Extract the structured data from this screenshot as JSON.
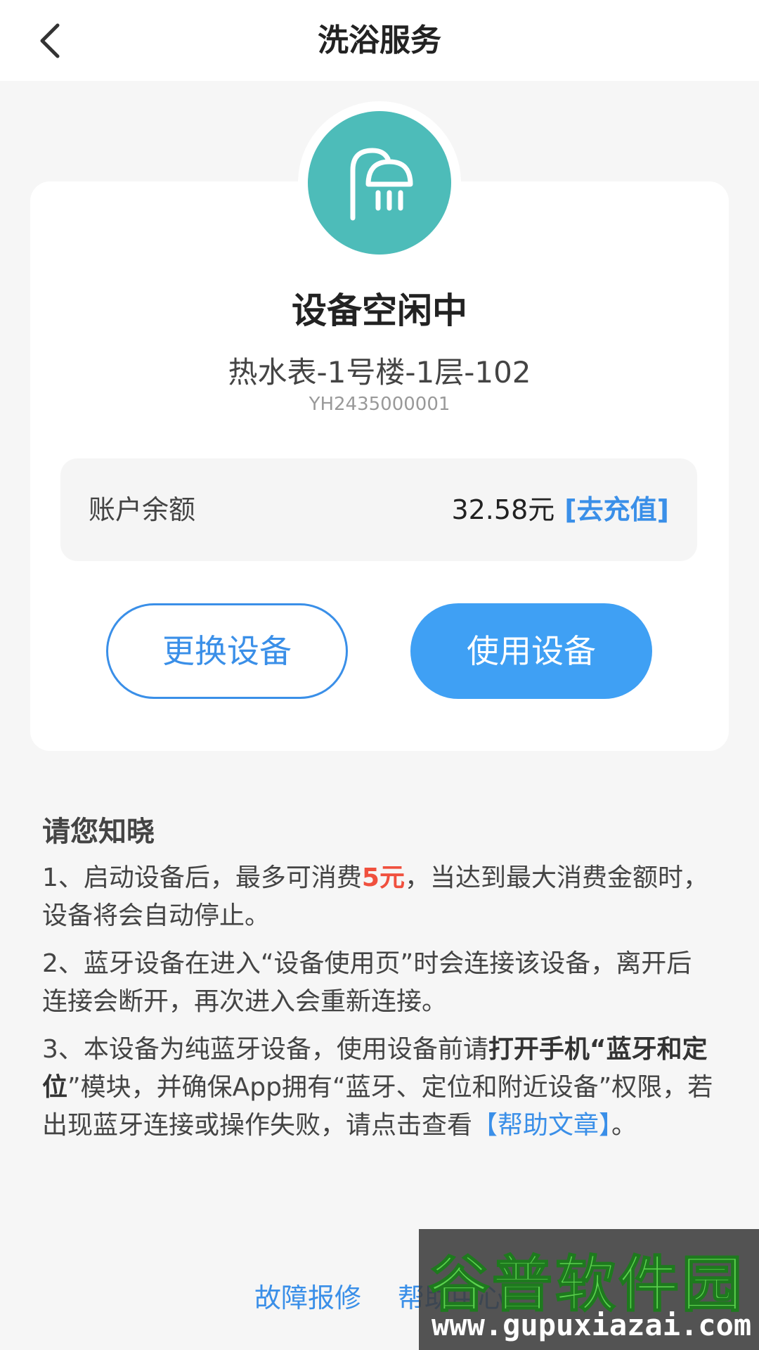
{
  "header": {
    "title": "洗浴服务",
    "back_icon": "chevron-left-icon"
  },
  "device": {
    "icon": "shower-icon",
    "icon_color": "#4dbcb9",
    "status": "设备空闲中",
    "name": "热水表-1号楼-1层-102",
    "id": "YH2435000001"
  },
  "balance": {
    "label": "账户余额",
    "value": "32.58元",
    "recharge_link": "[去充值]"
  },
  "actions": {
    "change_device": "更换设备",
    "use_device": "使用设备"
  },
  "notice": {
    "title": "请您知晓",
    "item1": {
      "before": "1、启动设备后，最多可消费",
      "highlight": "5元",
      "after": "，当达到最大消费金额时，设备将会自动停止。"
    },
    "item2": "2、蓝牙设备在进入“设备使用页”时会连接该设备，离开后连接会断开，再次进入会重新连接。",
    "item3": {
      "before": "3、本设备为纯蓝牙设备，使用设备前请",
      "bold": "打开手机“蓝牙和定位",
      "middle": "”模块，并确保App拥有“蓝牙、定位和附近设备”权限，若出现蓝牙连接或操作失败，请点击查看",
      "link": "【帮助文章】",
      "end": "。"
    }
  },
  "footer": {
    "repair_link": "故障报修",
    "help_link": "帮助中心"
  },
  "watermark": {
    "text": "谷普软件园",
    "url": "www.gupuxiazai.com"
  },
  "colors": {
    "accent": "#3a8fe8",
    "primary_button": "#3fa0f4",
    "highlight_red": "#f0503e"
  }
}
